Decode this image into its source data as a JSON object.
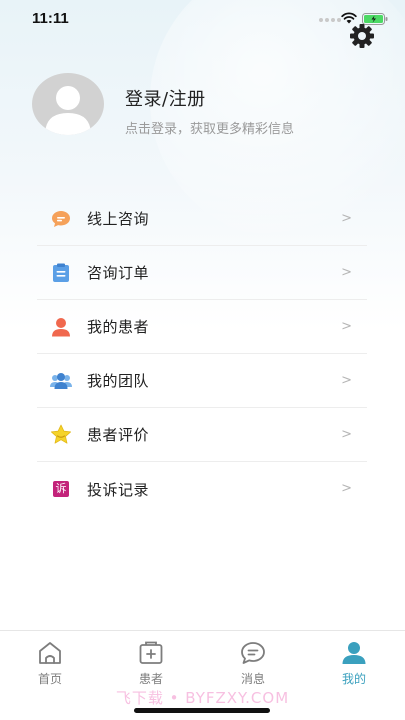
{
  "status_bar": {
    "time": "11:11"
  },
  "profile": {
    "title": "登录/注册",
    "subtitle": "点击登录，获取更多精彩信息"
  },
  "menu": [
    {
      "label": "线上咨询",
      "icon": "chat-bubble-icon",
      "color": "#f5a15a"
    },
    {
      "label": "咨询订单",
      "icon": "clipboard-icon",
      "color": "#5b9fe6"
    },
    {
      "label": "我的患者",
      "icon": "patient-icon",
      "color": "#f0684e"
    },
    {
      "label": "我的团队",
      "icon": "team-icon",
      "color": "#4a8ed8"
    },
    {
      "label": "患者评价",
      "icon": "star-icon",
      "color": "#f5d32a"
    },
    {
      "label": "投诉记录",
      "icon": "complaint-icon",
      "color": "#c3237a",
      "icon_text": "诉"
    }
  ],
  "chevron": ">",
  "tabbar": {
    "tabs": [
      {
        "label": "首页",
        "icon": "home-icon",
        "active": false
      },
      {
        "label": "患者",
        "icon": "patients-box-icon",
        "active": false
      },
      {
        "label": "消息",
        "icon": "message-icon",
        "active": false
      },
      {
        "label": "我的",
        "icon": "profile-icon",
        "active": true
      }
    ]
  },
  "watermark": "飞下载 • BYFZXY.COM",
  "colors": {
    "accent": "#3aa0be",
    "inactive": "#7d7d7d",
    "divider": "#ededed"
  }
}
